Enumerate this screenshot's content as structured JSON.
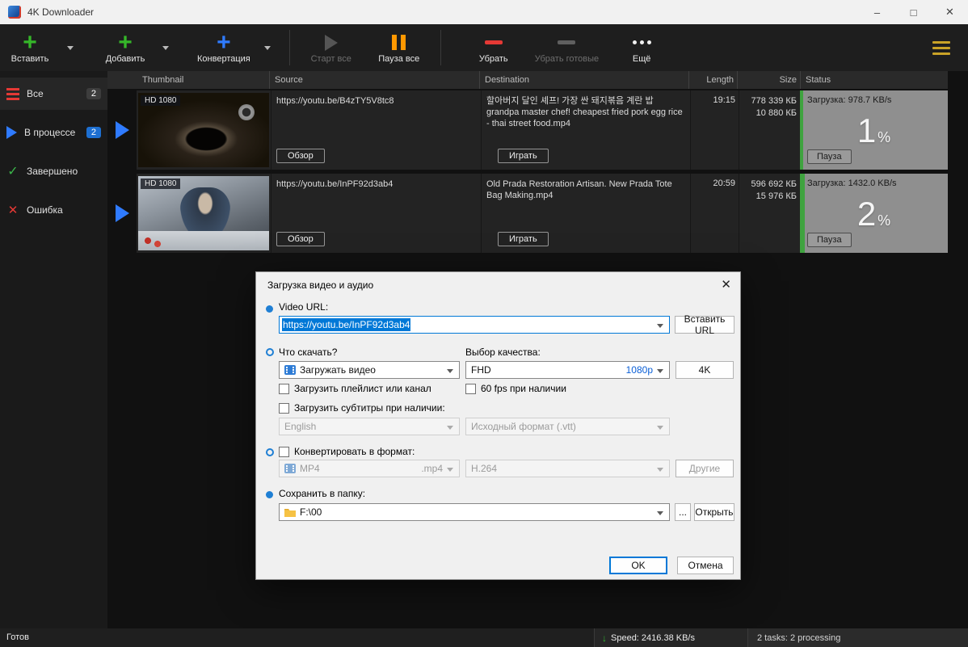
{
  "window": {
    "title": "4K Downloader"
  },
  "icons": {
    "plus": "+",
    "minimize": "–",
    "maximize": "□",
    "close": "✕",
    "check": "✓",
    "error_x": "✕",
    "speed_arrow": "↓"
  },
  "colors": {
    "accent_green": "#35b729",
    "accent_blue": "#2f7bff",
    "accent_orange": "#ff9800",
    "accent_red": "#e53935",
    "progress_green": "#3fa33f",
    "selection_blue": "#0078d7",
    "menu_gold": "#c9a227"
  },
  "toolbar": {
    "paste": "Вставить",
    "add": "Добавить",
    "convert": "Конвертация",
    "start_all": "Старт все",
    "pause_all": "Пауза все",
    "remove": "Убрать",
    "remove_done": "Убрать готовые",
    "more": "Ещё"
  },
  "sidebar": {
    "items": [
      {
        "label": "Все",
        "badge": "2"
      },
      {
        "label": "В процессе",
        "badge": "2"
      },
      {
        "label": "Завершено"
      },
      {
        "label": "Ошибка"
      }
    ]
  },
  "table": {
    "headers": [
      "Thumbnail",
      "Source",
      "Destination",
      "Length",
      "Size",
      "Status"
    ],
    "rows": [
      {
        "hd": "HD 1080",
        "source": "https://youtu.be/B4zTY5V8tc8",
        "browse": "Обзор",
        "destination": "할아버지 달인 셰프! 가장 싼 돼지볶음 계란 밥 grandpa master chef! cheapest fried pork egg rice - thai street food.mp4",
        "play": "Играть",
        "length": "19:15",
        "size_line1": "778 339 КБ",
        "size_line2": "10 880 КБ",
        "status": "Загрузка: 978.7 KB/s",
        "percent": "1",
        "pause": "Пауза"
      },
      {
        "hd": "HD 1080",
        "source": "https://youtu.be/InPF92d3ab4",
        "browse": "Обзор",
        "destination": "Old Prada Restoration Artisan. New Prada Tote Bag Making.mp4",
        "play": "Играть",
        "length": "20:59",
        "size_line1": "596 692 КБ",
        "size_line2": "15 976 КБ",
        "status": "Загрузка: 1432.0 KB/s",
        "percent": "2",
        "pause": "Пауза"
      }
    ]
  },
  "units": {
    "percent": "%"
  },
  "dialog": {
    "title": "Загрузка видео и аудио",
    "video_url_label": "Video URL:",
    "url_value": "https://youtu.be/InPF92d3ab4",
    "paste_url": "Вставить URL",
    "what_label": "Что скачать?",
    "quality_label": "Выбор качества:",
    "download_type": "Загружать видео",
    "quality_name": "FHD",
    "quality_res": "1080p",
    "four_k": "4K",
    "playlist_cb": "Загрузить плейлист или канал",
    "fps_cb": "60 fps при наличии",
    "subs_cb": "Загрузить субтитры при наличии:",
    "subs_lang": "English",
    "subs_format": "Исходный формат (.vtt)",
    "convert_cb": "Конвертировать в формат:",
    "convert_container": "MP4",
    "convert_ext": ".mp4",
    "convert_codec": "H.264",
    "other_btn": "Другие",
    "save_label": "Сохранить в папку:",
    "folder": "F:\\00",
    "dots_btn": "...",
    "open_btn": "Открыть",
    "ok": "OK",
    "cancel": "Отмена"
  },
  "statusbar": {
    "ready": "Готов",
    "speed": "Speed: 2416.38 KB/s",
    "tasks": "2 tasks: 2 processing"
  }
}
